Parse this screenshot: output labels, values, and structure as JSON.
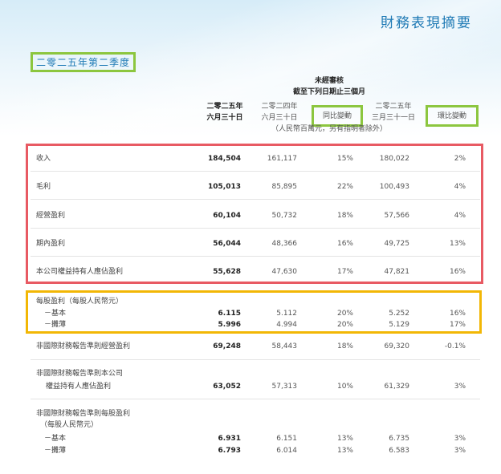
{
  "title": "財務表現摘要",
  "quarter": "二零二五年第二季度",
  "header": {
    "unaudited": "未經審核",
    "period": "截至下列日期止三個月",
    "col1_line1": "二零二五年",
    "col1_line2": "六月三十日",
    "col2_line1": "二零二四年",
    "col2_line2": "六月三十日",
    "col3": "同比變動",
    "col4_line1": "二零二五年",
    "col4_line2": "三月三十一日",
    "col5": "環比變動",
    "unit_note": "（人民幣百萬元，另有指明者除外）"
  },
  "rows": [
    {
      "label": "收入",
      "v1": "184,504",
      "v2": "161,117",
      "v3": "15%",
      "v4": "180,022",
      "v5": "2%"
    },
    {
      "label": "毛利",
      "v1": "105,013",
      "v2": "85,895",
      "v3": "22%",
      "v4": "100,493",
      "v5": "4%"
    },
    {
      "label": "經營盈利",
      "v1": "60,104",
      "v2": "50,732",
      "v3": "18%",
      "v4": "57,566",
      "v5": "4%"
    },
    {
      "label": "期內盈利",
      "v1": "56,044",
      "v2": "48,366",
      "v3": "16%",
      "v4": "49,725",
      "v5": "13%"
    },
    {
      "label": "本公司權益持有人應佔盈利",
      "v1": "55,628",
      "v2": "47,630",
      "v3": "17%",
      "v4": "47,821",
      "v5": "16%"
    }
  ],
  "eps": {
    "label": "每股盈利（每股人民幣元）",
    "basic": {
      "label": "－基本",
      "v1": "6.115",
      "v2": "5.112",
      "v3": "20%",
      "v4": "5.252",
      "v5": "16%"
    },
    "diluted": {
      "label": "－攤薄",
      "v1": "5.996",
      "v2": "4.994",
      "v3": "20%",
      "v4": "5.129",
      "v5": "17%"
    }
  },
  "nonifrs_op": {
    "label": "非國際財務報告準則經營盈利",
    "v1": "69,248",
    "v2": "58,443",
    "v3": "18%",
    "v4": "69,320",
    "v5": "-0.1%"
  },
  "nonifrs_attr": {
    "label_line1": "非國際財務報告準則本公司",
    "label_line2": "權益持有人應佔盈利",
    "v1": "63,052",
    "v2": "57,313",
    "v3": "10%",
    "v4": "61,329",
    "v5": "3%"
  },
  "nonifrs_eps": {
    "label_line1": "非國際財務報告準則每股盈利",
    "label_line2": "（每股人民幣元）",
    "basic": {
      "label": "－基本",
      "v1": "6.931",
      "v2": "6.151",
      "v3": "13%",
      "v4": "6.735",
      "v5": "3%"
    },
    "diluted": {
      "label": "－攤薄",
      "v1": "6.793",
      "v2": "6.014",
      "v3": "13%",
      "v4": "6.583",
      "v5": "3%"
    }
  },
  "colors": {
    "title": "#1f7ab5",
    "green": "#8cc63f",
    "red": "#e85a63",
    "yellow": "#f2b705"
  }
}
